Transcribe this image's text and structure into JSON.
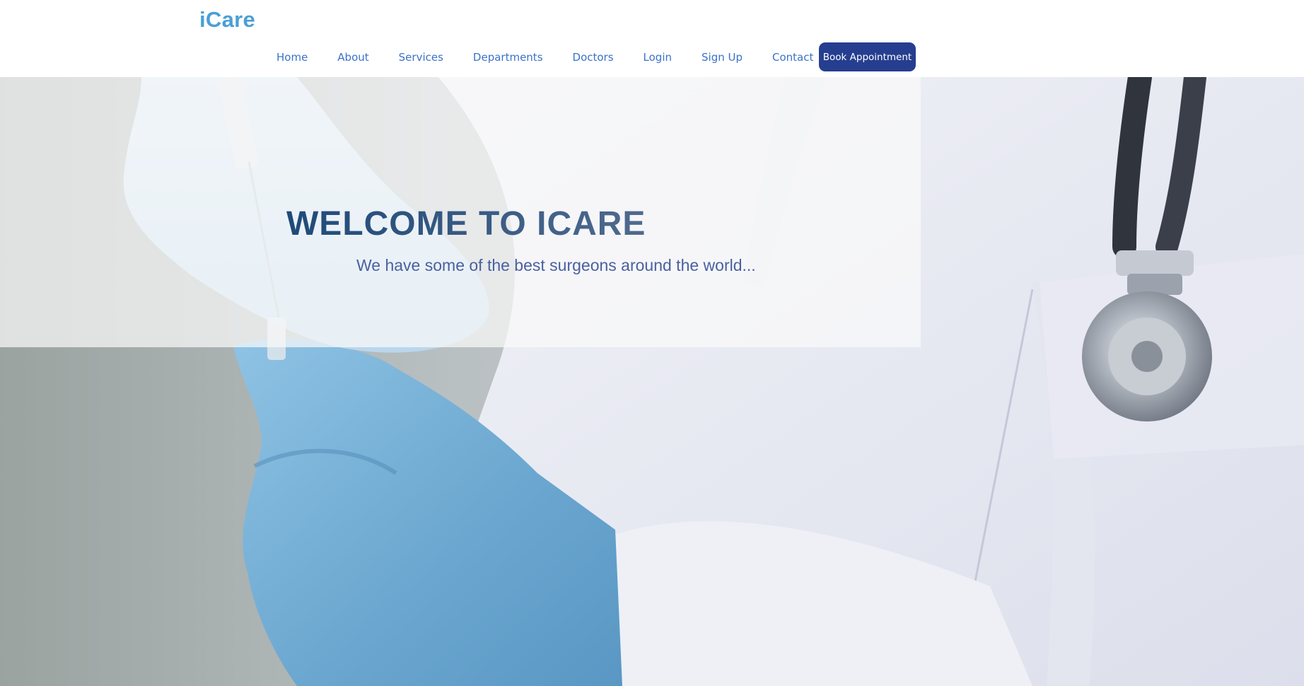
{
  "brand": {
    "name": "iCare"
  },
  "nav": {
    "items": [
      {
        "label": "Home"
      },
      {
        "label": "About"
      },
      {
        "label": "Services"
      },
      {
        "label": "Departments"
      },
      {
        "label": "Doctors"
      },
      {
        "label": "Login"
      },
      {
        "label": "Sign Up"
      },
      {
        "label": "Contact"
      }
    ],
    "cta_label": "Book Appointment"
  },
  "hero": {
    "title": "WELCOME TO ICARE",
    "subtitle": "We have some of the best surgeons around the world...",
    "image_description_icon": "doctor-with-syringe-image"
  },
  "colors": {
    "brand": "#4a9fd6",
    "nav_link": "#3b72c9",
    "cta_bg": "#263e8f",
    "title": "#1f4a78",
    "subtitle": "#4a61a0"
  }
}
